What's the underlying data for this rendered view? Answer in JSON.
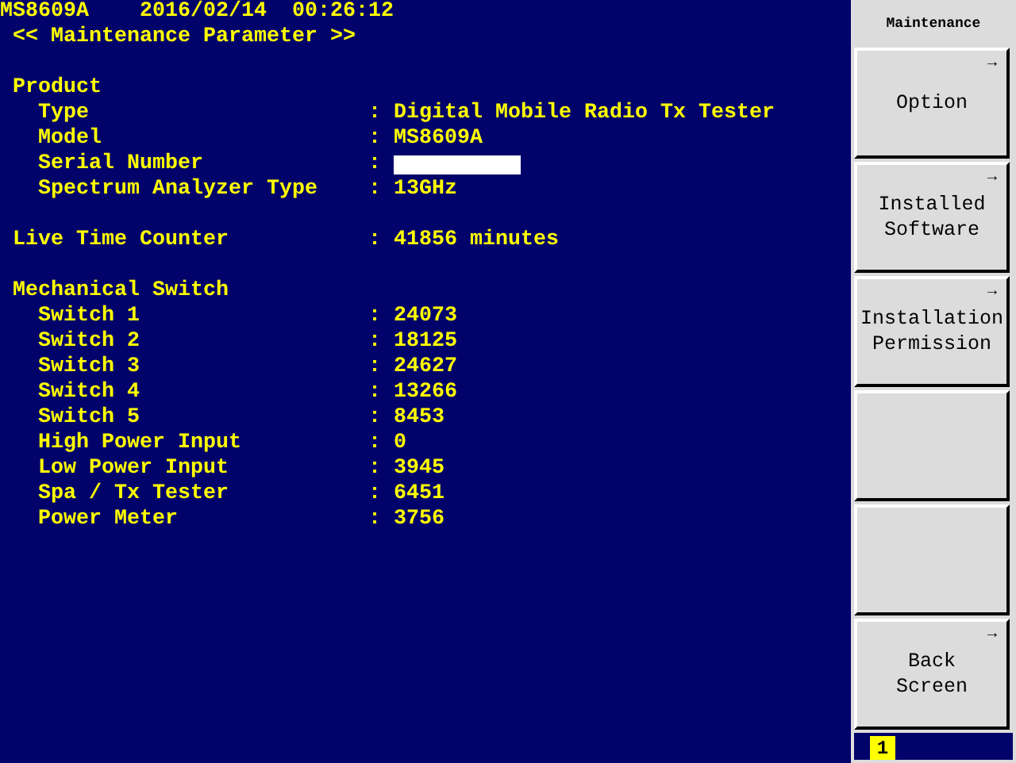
{
  "header": {
    "model": "MS8609A",
    "date": "2016/02/14",
    "time": "00:26:12"
  },
  "screen_title": "<< Maintenance Parameter >>",
  "sections": [
    {
      "title": "Product",
      "items": [
        {
          "label": "Type",
          "colon": ":",
          "value": "Digital Mobile Radio Tx Tester"
        },
        {
          "label": "Model",
          "colon": ":",
          "value": "MS8609A"
        },
        {
          "label": "Serial Number",
          "colon": ":",
          "redacted": true
        },
        {
          "label": "Spectrum Analyzer Type",
          "colon": ":",
          "value": "13GHz"
        }
      ]
    },
    {
      "title": "Live Time Counter",
      "colon": ":",
      "value": "41856 minutes"
    },
    {
      "title": "Mechanical Switch",
      "items": [
        {
          "label": "Switch 1",
          "colon": ":",
          "value": "24073"
        },
        {
          "label": "Switch 2",
          "colon": ":",
          "value": "18125"
        },
        {
          "label": "Switch 3",
          "colon": ":",
          "value": "24627"
        },
        {
          "label": "Switch 4",
          "colon": ":",
          "value": "13266"
        },
        {
          "label": "Switch 5",
          "colon": ":",
          "value": "8453"
        },
        {
          "label": "High Power Input",
          "colon": ":",
          "value": "0"
        },
        {
          "label": "Low Power Input",
          "colon": ":",
          "value": "3945"
        },
        {
          "label": "Spa / Tx Tester",
          "colon": ":",
          "value": "6451"
        },
        {
          "label": "Power Meter",
          "colon": ":",
          "value": "3756"
        }
      ]
    }
  ],
  "panel": {
    "title": "Maintenance",
    "softkeys": [
      {
        "kind": "key",
        "arrow": "→",
        "lines": [
          "Option"
        ]
      },
      {
        "kind": "key",
        "arrow": "→",
        "lines": [
          "Installed",
          "Software"
        ]
      },
      {
        "kind": "key",
        "arrow": "→",
        "lines": [
          "Installation",
          "Permission"
        ]
      },
      {
        "kind": "blank"
      },
      {
        "kind": "blank"
      },
      {
        "kind": "key",
        "arrow": "→",
        "lines": [
          "Back",
          "Screen"
        ]
      }
    ],
    "page_indicator": "1"
  }
}
